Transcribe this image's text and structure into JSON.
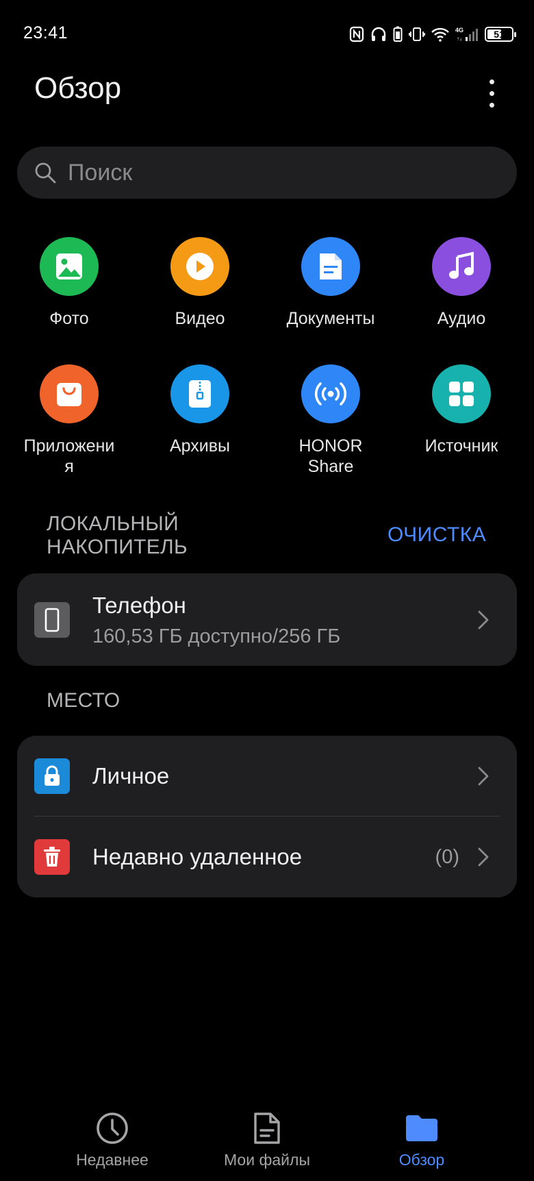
{
  "status_bar": {
    "time": "23:41",
    "network": "4G",
    "battery": "51"
  },
  "header": {
    "title": "Обзор"
  },
  "search": {
    "placeholder": "Поиск"
  },
  "categories": [
    {
      "label": "Фото",
      "icon": "photo-icon",
      "color": "#1db954"
    },
    {
      "label": "Видео",
      "icon": "video-icon",
      "color": "#f59a14"
    },
    {
      "label": "Документы",
      "icon": "document-icon",
      "color": "#2f86f6"
    },
    {
      "label": "Аудио",
      "icon": "music-icon",
      "color": "#8b4fe0"
    },
    {
      "label": "Приложени я",
      "icon": "app-store-icon",
      "color": "#f0642c"
    },
    {
      "label": "Архивы",
      "icon": "archive-icon",
      "color": "#1a96e8"
    },
    {
      "label": "HONOR Share",
      "icon": "share-icon",
      "color": "#2f86f6"
    },
    {
      "label": "Источник",
      "icon": "grid-icon",
      "color": "#17b1ae"
    }
  ],
  "local_storage": {
    "title_line1": "ЛОКАЛЬНЫЙ",
    "title_line2": "НАКОПИТЕЛЬ",
    "clean_label": "ОЧИСТКА",
    "phone": {
      "title": "Телефон",
      "detail": "160,53 ГБ доступно/256 ГБ"
    }
  },
  "places": {
    "title": "МЕСТО",
    "items": [
      {
        "title": "Личное",
        "icon": "lock-icon",
        "color": "#1a8ad9"
      },
      {
        "title": "Недавно удаленное",
        "count": "(0)",
        "icon": "trash-icon",
        "color": "#e03a3a"
      }
    ]
  },
  "bottom_nav": {
    "items": [
      {
        "label": "Недавнее",
        "icon": "clock-icon",
        "active": false
      },
      {
        "label": "Мои файлы",
        "icon": "file-icon",
        "active": false
      },
      {
        "label": "Обзор",
        "icon": "folder-icon",
        "active": true
      }
    ],
    "accent": "#4d8bff"
  }
}
